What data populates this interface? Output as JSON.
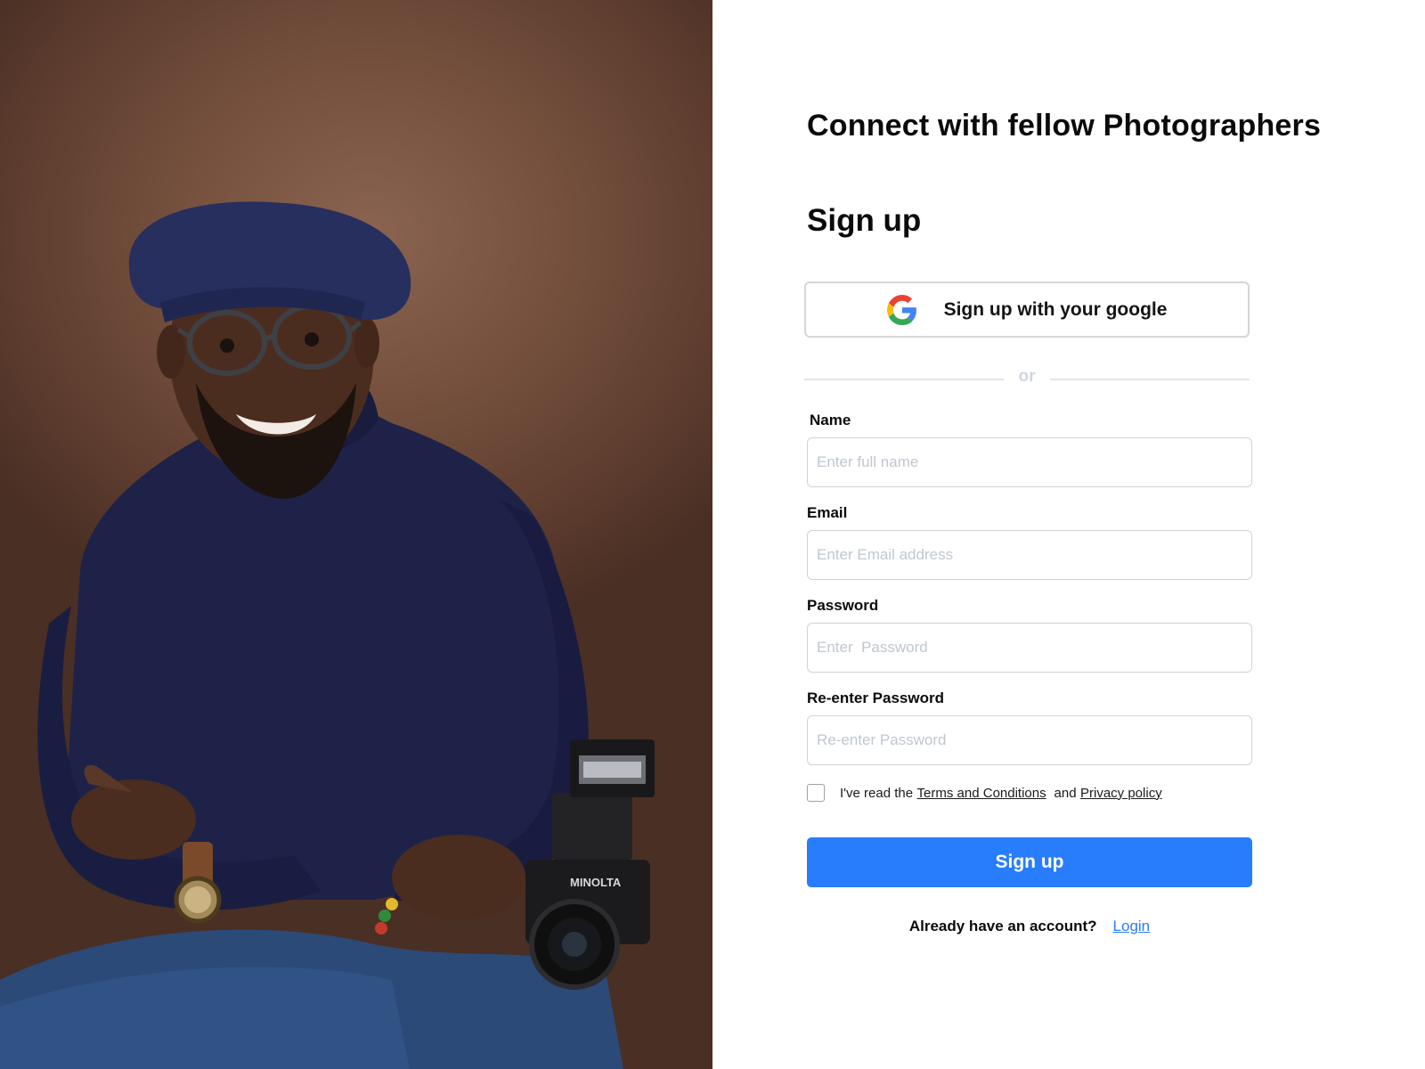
{
  "hero": {
    "alt": "Smiling photographer wearing a navy beret and glasses, holding a camera",
    "camera_brand": "MINOLTA",
    "background_color": "#76513e",
    "sweater_color": "#1e2248"
  },
  "headline": "Connect with fellow Photographers",
  "form": {
    "title": "Sign up",
    "google_button": "Sign up with your google",
    "divider": "or",
    "fields": [
      {
        "label": "Name",
        "placeholder": "Enter full name"
      },
      {
        "label": "Email",
        "placeholder": "Enter Email address"
      },
      {
        "label": "Password",
        "placeholder": "Enter  Password"
      },
      {
        "label": "Re-enter Password",
        "placeholder": "Re-enter Password"
      }
    ],
    "terms": {
      "prefix": "I've read the",
      "terms_link": "Terms and Conditions",
      "and": "and",
      "privacy_link": "Privacy policy"
    },
    "submit_label": "Sign up",
    "login_prompt": "Already have an account?",
    "login_link": "Login"
  },
  "colors": {
    "primary": "#277dfb",
    "input_border": "#cfd3d8",
    "placeholder": "#c0c7cf"
  }
}
